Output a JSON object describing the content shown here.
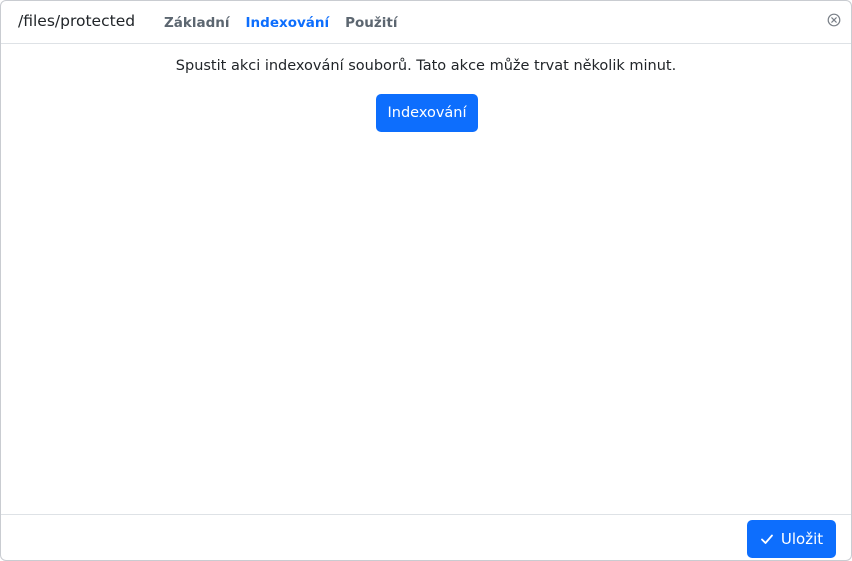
{
  "dialog": {
    "title": "/files/protected",
    "tabs": [
      {
        "label": "Základní",
        "active": false
      },
      {
        "label": "Indexování",
        "active": true
      },
      {
        "label": "Použití",
        "active": false
      }
    ],
    "close_icon": "circle-x-icon"
  },
  "content": {
    "message": "Spustit akci indexování souborů. Tato akce může trvat několik minut.",
    "index_button_label": "Indexování"
  },
  "footer": {
    "save_label": "Uložit",
    "save_icon": "check-icon"
  },
  "colors": {
    "accent": "#0d6efd",
    "tab_inactive": "#5c6670",
    "border": "#dee2e6"
  }
}
